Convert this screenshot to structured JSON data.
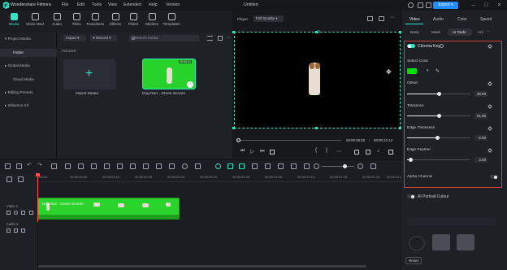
{
  "app": {
    "name": "Wondershare Filmora",
    "window_title": "Untitled",
    "menu": [
      "File",
      "Edit",
      "Tools",
      "View",
      "Extended",
      "Help",
      "Version"
    ],
    "export_label": "Export",
    "accent": "#2ee6c4",
    "brand_blue": "#1f8cff"
  },
  "toolbar": {
    "tools": [
      "Media",
      "Stock Media",
      "Audio",
      "Titles",
      "Transitions",
      "Effects",
      "Filters",
      "Stickers",
      "Templates"
    ],
    "active": "Media"
  },
  "sidebar": {
    "items": [
      {
        "label": "Project Media",
        "icon": "chevron-down-icon"
      },
      {
        "label": "Folder",
        "icon": ""
      },
      {
        "label": "Global Media",
        "icon": "chevron-right-icon"
      },
      {
        "label": "Cloud Media",
        "icon": ""
      },
      {
        "label": "Editing Presets",
        "icon": "chevron-right-icon"
      },
      {
        "label": "Influence Kit",
        "icon": "chevron-right-icon"
      }
    ]
  },
  "media": {
    "import_dropdown": "Import",
    "record_dropdown": "Record",
    "search_placeholder": "Search media",
    "folder_label": "FOLDER",
    "import_tile_label": "Import Media",
    "clip_name": "Dog Run - Green Screen",
    "clip_duration": "00:00:21"
  },
  "player": {
    "label": "Player",
    "quality": "Full Quality",
    "current_time": "00:00:00:00",
    "total_time": "00:00:21:14"
  },
  "right_panel": {
    "tabs": [
      "Video",
      "Audio",
      "Color",
      "Speed"
    ],
    "active_tab": "Video",
    "subtabs": [
      "Basic",
      "Mask",
      "AI Tools",
      "Ani"
    ],
    "active_subtab": "AI Tools",
    "chroma_key": {
      "title": "Chroma Key",
      "enabled": true,
      "select_color_label": "Select Color",
      "selected_color": "#00e000",
      "offset": {
        "label": "Offset",
        "value": "20.00",
        "fraction": 0.5
      },
      "tolerance": {
        "label": "Tolerance",
        "value": "51.00",
        "fraction": 0.51
      },
      "edge_thickness": {
        "label": "Edge Thickness",
        "value": "-2.00",
        "fraction": 0.48
      },
      "edge_feather": {
        "label": "Edge Feather",
        "value": "2.00",
        "fraction": 0.06
      },
      "alpha_channel": {
        "label": "Alpha Channel",
        "enabled": false
      }
    },
    "ai_portrait": {
      "label": "AI Portrait Cutout",
      "enabled": false
    },
    "reset_label": "Reset"
  },
  "timeline": {
    "ruler_ticks": [
      "00:00",
      "00:00:00:05",
      "00:00:00:10",
      "00:00:00:15",
      "00:00:00:20",
      "00:00:00:25",
      "00:00:01:00",
      "00:00:01:05",
      "00:00:01:10",
      "00:00:01:15",
      "00:00:01:20",
      "00:00:01:25"
    ],
    "tracks": [
      {
        "label": "Video 1"
      },
      {
        "label": "Audio 1"
      }
    ],
    "clip_label": "Dog Run - Green Screen",
    "clip_color": "#2bd42b"
  }
}
